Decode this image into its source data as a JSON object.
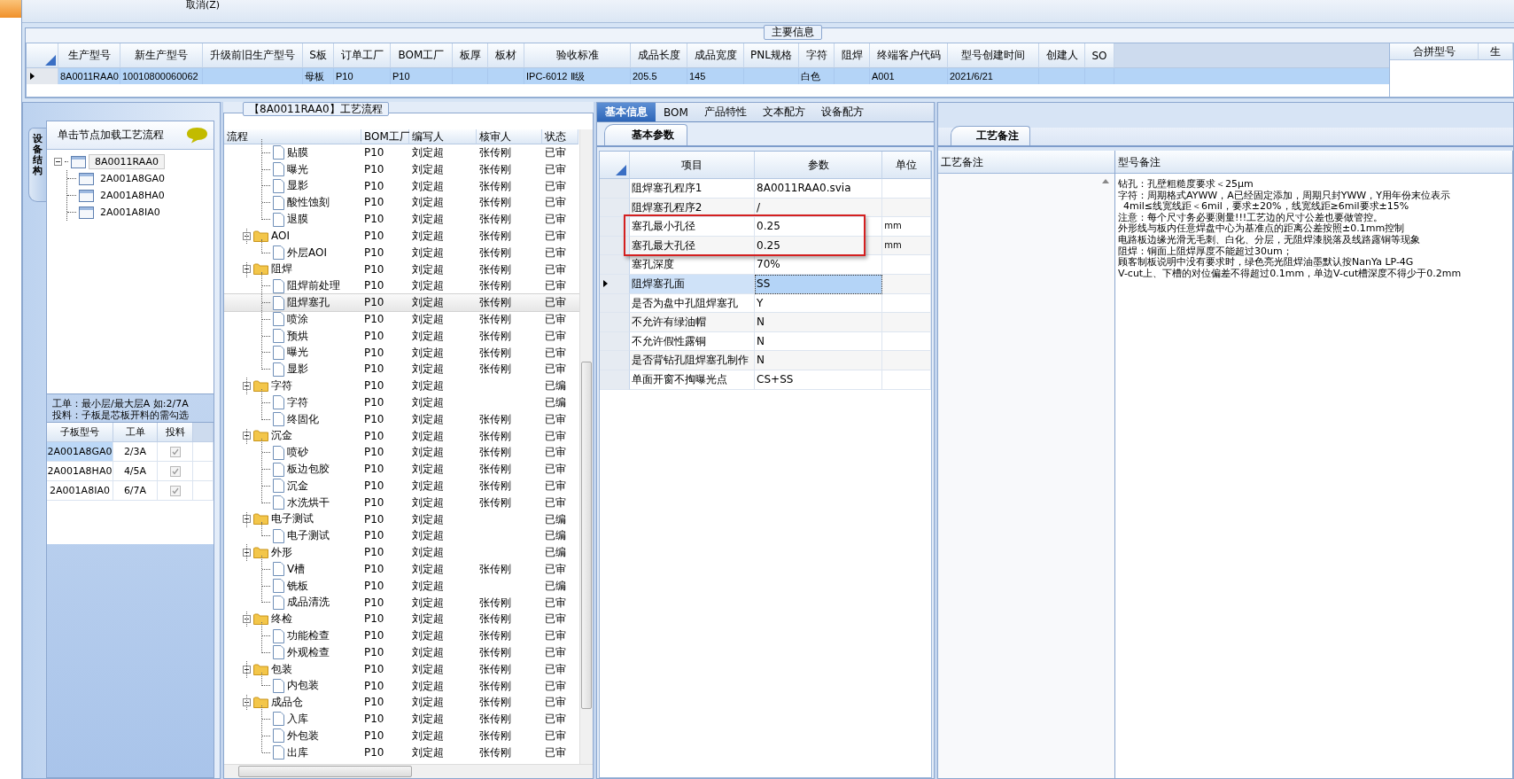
{
  "toolbar": {
    "cancel": "取消(Z)"
  },
  "main_info": {
    "title": "主要信息",
    "columns": [
      "生产型号",
      "新生产型号",
      "升级前旧生产型号",
      "S板",
      "订单工厂",
      "BOM工厂",
      "板厚",
      "板材",
      "验收标准",
      "成品长度",
      "成品宽度",
      "PNL规格",
      "字符",
      "阻焊",
      "终端客户代码",
      "型号创建时间",
      "创建人",
      "SO"
    ],
    "rows": [
      {
        "selected": true,
        "cells": [
          "8A0011RAA0",
          "10010800060062",
          null,
          "母板",
          "P10",
          "P10",
          null,
          null,
          "IPC-6012 Ⅱ级",
          "205.5",
          "145",
          null,
          "白色",
          null,
          "A001",
          "2021/6/21",
          null,
          null
        ]
      }
    ],
    "merge_table": {
      "columns": [
        "合拼型号",
        "生"
      ]
    }
  },
  "structure_panel": {
    "tab": "设备结构",
    "header": "单击节点加载工艺流程",
    "tree": [
      {
        "label": "8A0011RAA0",
        "expanded": true,
        "children": [
          {
            "label": "2A001A8GA0"
          },
          {
            "label": "2A001A8HA0"
          },
          {
            "label": "2A001A8IA0"
          }
        ]
      }
    ],
    "notes": [
      "工单：最小层/最大层A 如:2/7A",
      "投料：子板是芯板开料的需勾选"
    ],
    "sub_boards": {
      "columns": [
        "子板型号",
        "工单",
        "投料"
      ],
      "rows": [
        {
          "model": "2A001A8GA0",
          "work_order": "2/3A",
          "feed": true,
          "selected": true
        },
        {
          "model": "2A001A8HA0",
          "work_order": "4/5A",
          "feed": true,
          "selected": false
        },
        {
          "model": "2A001A8IA0",
          "work_order": "6/7A",
          "feed": true,
          "selected": false
        }
      ]
    }
  },
  "flow_panel": {
    "title": "【8A0011RAA0】工艺流程",
    "columns": [
      "流程",
      "BOM工厂",
      "编写人",
      "核审人",
      "状态"
    ],
    "nodes": [
      {
        "kind": "group",
        "children": [
          {
            "kind": "step",
            "label": "贴膜",
            "bom": "P10",
            "writer": "刘定超",
            "reviewer": "张传刚",
            "status": "已审",
            "selected": false
          },
          {
            "kind": "step",
            "label": "曝光",
            "bom": "P10",
            "writer": "刘定超",
            "reviewer": "张传刚",
            "status": "已审",
            "selected": false
          },
          {
            "kind": "step",
            "label": "显影",
            "bom": "P10",
            "writer": "刘定超",
            "reviewer": "张传刚",
            "status": "已审",
            "selected": false
          },
          {
            "kind": "step",
            "label": "酸性蚀刻",
            "bom": "P10",
            "writer": "刘定超",
            "reviewer": "张传刚",
            "status": "已审",
            "selected": false
          },
          {
            "kind": "step",
            "label": "退膜",
            "bom": "P10",
            "writer": "刘定超",
            "reviewer": "张传刚",
            "status": "已审",
            "selected": false
          }
        ]
      },
      {
        "kind": "folder",
        "label": "AOI",
        "bom": "P10",
        "writer": "刘定超",
        "reviewer": "张传刚",
        "status": "已审",
        "expanded": true,
        "selected": false,
        "children": [
          {
            "kind": "step",
            "label": "外层AOI",
            "bom": "P10",
            "writer": "刘定超",
            "reviewer": "张传刚",
            "status": "已审",
            "selected": false
          }
        ]
      },
      {
        "kind": "folder",
        "label": "阻焊",
        "bom": "P10",
        "writer": "刘定超",
        "reviewer": "张传刚",
        "status": "已审",
        "expanded": true,
        "selected": false,
        "children": [
          {
            "kind": "step",
            "label": "阻焊前处理",
            "bom": "P10",
            "writer": "刘定超",
            "reviewer": "张传刚",
            "status": "已审",
            "selected": false
          },
          {
            "kind": "step",
            "label": "阻焊塞孔",
            "bom": "P10",
            "writer": "刘定超",
            "reviewer": "张传刚",
            "status": "已审",
            "selected": true
          },
          {
            "kind": "step",
            "label": "喷涂",
            "bom": "P10",
            "writer": "刘定超",
            "reviewer": "张传刚",
            "status": "已审",
            "selected": false
          },
          {
            "kind": "step",
            "label": "预烘",
            "bom": "P10",
            "writer": "刘定超",
            "reviewer": "张传刚",
            "status": "已审",
            "selected": false
          },
          {
            "kind": "step",
            "label": "曝光",
            "bom": "P10",
            "writer": "刘定超",
            "reviewer": "张传刚",
            "status": "已审",
            "selected": false
          },
          {
            "kind": "step",
            "label": "显影",
            "bom": "P10",
            "writer": "刘定超",
            "reviewer": "张传刚",
            "status": "已审",
            "selected": false
          }
        ]
      },
      {
        "kind": "folder",
        "label": "字符",
        "bom": "P10",
        "writer": "刘定超",
        "status": "已编",
        "expanded": true,
        "selected": false,
        "children": [
          {
            "kind": "step",
            "label": "字符",
            "bom": "P10",
            "writer": "刘定超",
            "status": "已编",
            "selected": false
          },
          {
            "kind": "step",
            "label": "终固化",
            "bom": "P10",
            "writer": "刘定超",
            "reviewer": "张传刚",
            "status": "已审",
            "selected": false
          }
        ]
      },
      {
        "kind": "folder",
        "label": "沉金",
        "bom": "P10",
        "writer": "刘定超",
        "reviewer": "张传刚",
        "status": "已审",
        "expanded": true,
        "selected": false,
        "children": [
          {
            "kind": "step",
            "label": "喷砂",
            "bom": "P10",
            "writer": "刘定超",
            "reviewer": "张传刚",
            "status": "已审",
            "selected": false
          },
          {
            "kind": "step",
            "label": "板边包胶",
            "bom": "P10",
            "writer": "刘定超",
            "reviewer": "张传刚",
            "status": "已审",
            "selected": false
          },
          {
            "kind": "step",
            "label": "沉金",
            "bom": "P10",
            "writer": "刘定超",
            "reviewer": "张传刚",
            "status": "已审",
            "selected": false
          },
          {
            "kind": "step",
            "label": "水洗烘干",
            "bom": "P10",
            "writer": "刘定超",
            "reviewer": "张传刚",
            "status": "已审",
            "selected": false
          }
        ]
      },
      {
        "kind": "folder",
        "label": "电子测试",
        "bom": "P10",
        "writer": "刘定超",
        "status": "已编",
        "expanded": true,
        "selected": false,
        "children": [
          {
            "kind": "step",
            "label": "电子测试",
            "bom": "P10",
            "writer": "刘定超",
            "status": "已编",
            "selected": false
          }
        ]
      },
      {
        "kind": "folder",
        "label": "外形",
        "bom": "P10",
        "writer": "刘定超",
        "status": "已编",
        "expanded": true,
        "selected": false,
        "children": [
          {
            "kind": "step",
            "label": "V槽",
            "bom": "P10",
            "writer": "刘定超",
            "reviewer": "张传刚",
            "status": "已审",
            "selected": false
          },
          {
            "kind": "step",
            "label": "铣板",
            "bom": "P10",
            "writer": "刘定超",
            "status": "已编",
            "selected": false
          },
          {
            "kind": "step",
            "label": "成品清洗",
            "bom": "P10",
            "writer": "刘定超",
            "reviewer": "张传刚",
            "status": "已审",
            "selected": false
          }
        ]
      },
      {
        "kind": "folder",
        "label": "终检",
        "bom": "P10",
        "writer": "刘定超",
        "reviewer": "张传刚",
        "status": "已审",
        "expanded": true,
        "selected": false,
        "children": [
          {
            "kind": "step",
            "label": "功能检查",
            "bom": "P10",
            "writer": "刘定超",
            "reviewer": "张传刚",
            "status": "已审",
            "selected": false
          },
          {
            "kind": "step",
            "label": "外观检查",
            "bom": "P10",
            "writer": "刘定超",
            "reviewer": "张传刚",
            "status": "已审",
            "selected": false
          }
        ]
      },
      {
        "kind": "folder",
        "label": "包装",
        "bom": "P10",
        "writer": "刘定超",
        "reviewer": "张传刚",
        "status": "已审",
        "expanded": true,
        "selected": false,
        "children": [
          {
            "kind": "step",
            "label": "内包装",
            "bom": "P10",
            "writer": "刘定超",
            "reviewer": "张传刚",
            "status": "已审",
            "selected": false
          }
        ]
      },
      {
        "kind": "folder",
        "label": "成品仓",
        "bom": "P10",
        "writer": "刘定超",
        "reviewer": "张传刚",
        "status": "已审",
        "expanded": true,
        "selected": false,
        "children": [
          {
            "kind": "step",
            "label": "入库",
            "bom": "P10",
            "writer": "刘定超",
            "reviewer": "张传刚",
            "status": "已审",
            "selected": false
          },
          {
            "kind": "step",
            "label": "外包装",
            "bom": "P10",
            "writer": "刘定超",
            "reviewer": "张传刚",
            "status": "已审",
            "selected": false
          },
          {
            "kind": "step",
            "label": "出库",
            "bom": "P10",
            "writer": "刘定超",
            "reviewer": "张传刚",
            "status": "已审",
            "selected": false
          }
        ]
      }
    ]
  },
  "params_panel": {
    "tabs": [
      {
        "label": "基本信息",
        "selected": true
      },
      {
        "label": "BOM",
        "selected": false
      },
      {
        "label": "产品特性",
        "selected": false
      },
      {
        "label": "文本配方",
        "selected": false
      },
      {
        "label": "设备配方",
        "selected": false
      }
    ],
    "subtab": "基本参数",
    "columns": [
      "项目",
      "参数",
      "单位"
    ],
    "rows": [
      {
        "item": "阻焊塞孔程序1",
        "value": "8A0011RAA0.svia",
        "selected": false
      },
      {
        "item": "阻焊塞孔程序2",
        "value": "/",
        "selected": false
      },
      {
        "item": "塞孔最小孔径",
        "value": "0.25",
        "unit": "mm",
        "selected": false
      },
      {
        "item": "塞孔最大孔径",
        "value": "0.25",
        "unit": "mm",
        "selected": false
      },
      {
        "item": "塞孔深度",
        "value": "70%",
        "selected": false
      },
      {
        "item": "阻焊塞孔面",
        "value": "SS",
        "selected": true
      },
      {
        "item": "是否为盘中孔阻焊塞孔",
        "value": "Y",
        "selected": false
      },
      {
        "item": "不允许有绿油帽",
        "value": "N",
        "selected": false
      },
      {
        "item": "不允许假性露铜",
        "value": "N",
        "selected": false
      },
      {
        "item": "是否背钻孔阻焊塞孔制作",
        "value": "N",
        "selected": false
      },
      {
        "item": "单面开窗不掏曝光点",
        "value": "CS+SS",
        "selected": false
      }
    ]
  },
  "notes_panel": {
    "tab": "工艺备注",
    "columns": [
      "工艺备注",
      "型号备注"
    ],
    "model_notes": [
      "钻孔：孔壁粗糙度要求＜25μm",
      "字符：周期格式AYWW，A已经固定添加，周期只封YWW，Y用年份末位表示",
      "4mil≤线宽线距＜6mil，要求±20%，线宽线距≥6mil要求±15%",
      "注意：每个尺寸务必要测量!!!工艺边的尺寸公差也要做管控。",
      "外形线与板内任意焊盘中心为基准点的距离公差按照±0.1mm控制",
      "电路板边缘光滑无毛刺、白化、分层，无阻焊漆脱落及线路露铜等现象",
      "阻焊：铜面上阻焊厚度不能超过30um；",
      "顾客制板说明中没有要求时，绿色亮光阻焊油墨默认按NanYa LP-4G",
      "V-cut上、下槽的对位偏差不得超过0.1mm，单边V-cut槽深度不得少于0.2mm"
    ]
  }
}
